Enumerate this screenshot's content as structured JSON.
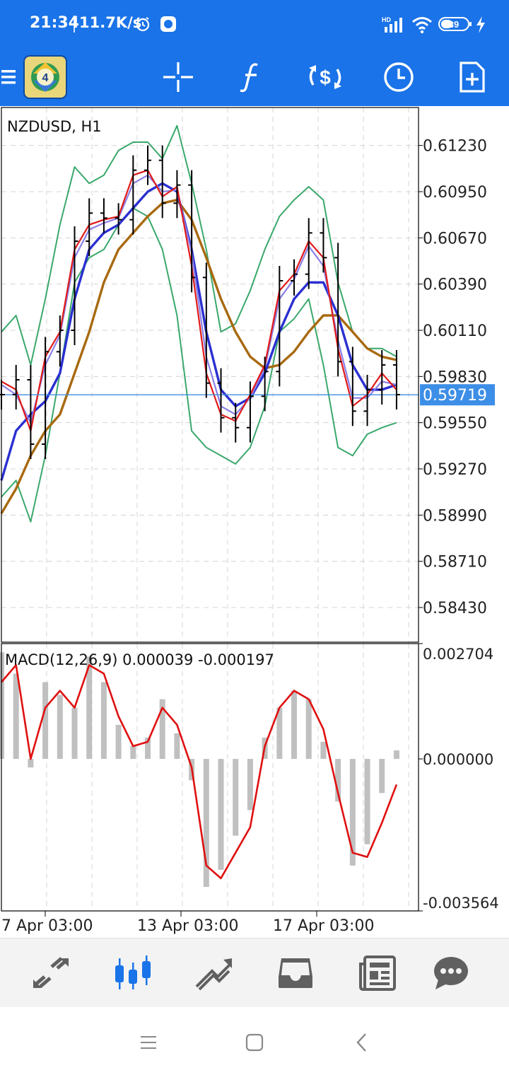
{
  "status_bar": {
    "time": "21:34",
    "speed": "11.7K/s",
    "battery": "39",
    "network": "HD",
    "icons": [
      "alarm-icon",
      "app-notification-icon",
      "signal-icon",
      "wifi-icon",
      "battery-icon",
      "charging-icon"
    ]
  },
  "toolbar": {
    "items": [
      "menu-icon",
      "metatrader-logo-icon",
      "crosshair-icon",
      "indicators-icon",
      "trade-icon",
      "timeframe-icon",
      "new-order-icon"
    ],
    "logo_text": "4"
  },
  "colors": {
    "accent": "#1a73e8",
    "bollinger": "#3aa86b",
    "ma_fast": "#e11919",
    "ma_blue": "#2a2fd1",
    "ma_violet": "#8a7fe6",
    "ma_slow": "#a8690f",
    "price_line": "#3d8ee6",
    "macd_hist": "#c0c0c0",
    "macd_signal": "#e01010",
    "grid": "#d4d4d4"
  },
  "chart_data": [
    {
      "type": "line",
      "title": "NZDUSD, H1",
      "symbol": "NZDUSD",
      "timeframe": "H1",
      "y_ticks": [
        "0.61230",
        "0.60950",
        "0.60670",
        "0.60390",
        "0.60110",
        "0.59830",
        "0.59550",
        "0.59270",
        "0.58990",
        "0.58710",
        "0.58430"
      ],
      "ylim": [
        0.5822,
        0.6146
      ],
      "current_price": "0.59719",
      "current_price_value": 0.59719,
      "x_ticks": [
        "7 Apr 03:00",
        "13 Apr 03:00",
        "17 Apr 03:00"
      ],
      "grid": true,
      "x": [
        0,
        10,
        20,
        30,
        40,
        50,
        60,
        70,
        80,
        90,
        100,
        110,
        120,
        130,
        140,
        150,
        160,
        170,
        180,
        190,
        200,
        210,
        220,
        230,
        240,
        250,
        260,
        270
      ],
      "close": [
        0.5972,
        0.5981,
        0.5942,
        0.5998,
        0.6011,
        0.6065,
        0.6082,
        0.6079,
        0.6078,
        0.6108,
        0.6114,
        0.6088,
        0.6099,
        0.6043,
        0.5979,
        0.5958,
        0.5952,
        0.5971,
        0.5986,
        0.6041,
        0.6045,
        0.607,
        0.6055,
        0.5992,
        0.5962,
        0.5975,
        0.599,
        0.5972
      ],
      "series": [
        {
          "name": "",
          "role": "bollinger_upper",
          "values": [
            0.601,
            0.602,
            0.599,
            0.603,
            0.6075,
            0.611,
            0.61,
            0.6105,
            0.612,
            0.6125,
            0.6125,
            0.6115,
            0.6135,
            0.61,
            0.606,
            0.601,
            0.6015,
            0.6035,
            0.606,
            0.608,
            0.609,
            0.6098,
            0.609,
            0.604,
            0.601,
            0.6,
            0.6,
            0.5995
          ]
        },
        {
          "name": "",
          "role": "bollinger_lower",
          "values": [
            0.591,
            0.592,
            0.5895,
            0.5935,
            0.5985,
            0.604,
            0.6055,
            0.606,
            0.6075,
            0.6085,
            0.608,
            0.606,
            0.602,
            0.595,
            0.594,
            0.5935,
            0.593,
            0.594,
            0.5965,
            0.601,
            0.6018,
            0.603,
            0.599,
            0.594,
            0.5935,
            0.5948,
            0.5952,
            0.5955
          ]
        },
        {
          "name": "",
          "role": "ma_fast",
          "values": [
            0.598,
            0.5975,
            0.595,
            0.5995,
            0.601,
            0.606,
            0.6075,
            0.6078,
            0.608,
            0.6105,
            0.6108,
            0.6092,
            0.6098,
            0.605,
            0.5985,
            0.596,
            0.5956,
            0.5972,
            0.599,
            0.6035,
            0.6045,
            0.6065,
            0.6055,
            0.6,
            0.5965,
            0.5972,
            0.5985,
            0.5975
          ]
        },
        {
          "name": "",
          "role": "ma_violet",
          "values": [
            0.5978,
            0.5972,
            0.5955,
            0.599,
            0.6008,
            0.6055,
            0.6072,
            0.6076,
            0.6079,
            0.61,
            0.6105,
            0.6095,
            0.6096,
            0.6058,
            0.5995,
            0.5965,
            0.596,
            0.597,
            0.5988,
            0.603,
            0.6042,
            0.6062,
            0.605,
            0.6005,
            0.597,
            0.597,
            0.598,
            0.5978
          ]
        },
        {
          "name": "",
          "role": "ma_blue",
          "values": [
            0.592,
            0.595,
            0.596,
            0.5968,
            0.5985,
            0.603,
            0.606,
            0.607,
            0.6075,
            0.6085,
            0.6095,
            0.61,
            0.6095,
            0.606,
            0.601,
            0.5975,
            0.5965,
            0.597,
            0.5985,
            0.601,
            0.603,
            0.604,
            0.604,
            0.602,
            0.599,
            0.5975,
            0.5975,
            0.5978
          ]
        },
        {
          "name": "",
          "role": "ma_slow",
          "values": [
            0.59,
            0.5915,
            0.5935,
            0.595,
            0.596,
            0.5985,
            0.601,
            0.604,
            0.606,
            0.607,
            0.608,
            0.6088,
            0.609,
            0.6078,
            0.6055,
            0.603,
            0.601,
            0.5995,
            0.5988,
            0.599,
            0.5998,
            0.601,
            0.602,
            0.602,
            0.601,
            0.6,
            0.5995,
            0.5993
          ]
        }
      ]
    },
    {
      "type": "bar",
      "title": "MACD(12,26,9) 0.000039 -0.000197",
      "indicator": "MACD(12,26,9)",
      "readout_main": "0.000039",
      "readout_signal": "-0.000197",
      "y_ticks": [
        "0.002704",
        "0.000000",
        "-0.003564"
      ],
      "ylim": [
        -0.003564,
        0.002704
      ],
      "x": [
        0,
        10,
        20,
        30,
        40,
        50,
        60,
        70,
        80,
        90,
        100,
        110,
        120,
        130,
        140,
        150,
        160,
        170,
        180,
        190,
        200,
        210,
        220,
        230,
        240,
        250,
        260,
        270
      ],
      "histogram": [
        0.0025,
        0.002,
        -0.0002,
        0.0018,
        0.0015,
        0.0012,
        0.0024,
        0.0018,
        0.0008,
        0.0003,
        0.0005,
        0.0014,
        0.0006,
        -0.0005,
        -0.003,
        -0.0026,
        -0.0018,
        -0.0012,
        0.0005,
        0.0012,
        0.0016,
        0.0014,
        0.0004,
        -0.001,
        -0.0025,
        -0.002,
        -0.0008,
        0.0002
      ],
      "signal": [
        0.0018,
        0.0022,
        0.0,
        0.0012,
        0.0016,
        0.0012,
        0.0022,
        0.002,
        0.001,
        0.0003,
        0.0004,
        0.0012,
        0.0008,
        -0.0002,
        -0.0025,
        -0.0028,
        -0.0022,
        -0.0016,
        0.0003,
        0.0012,
        0.0016,
        0.0014,
        0.0007,
        -0.0008,
        -0.0022,
        -0.0023,
        -0.0015,
        -0.0006
      ]
    }
  ],
  "bottom_nav": {
    "items": [
      "quotes-icon",
      "chart-icon",
      "trade-icon",
      "history-icon",
      "news-icon",
      "chat-icon"
    ],
    "active_index": 1
  },
  "system_nav": {
    "items": [
      "recents-icon",
      "home-icon",
      "back-icon"
    ]
  }
}
